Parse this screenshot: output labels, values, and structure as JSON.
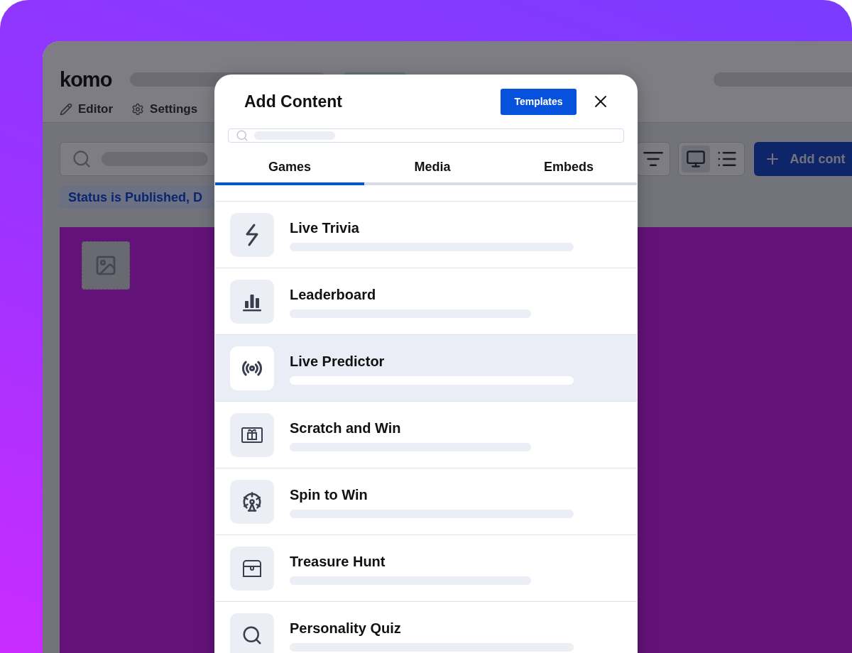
{
  "app": {
    "logo": "komo",
    "nav": [
      {
        "label": "Editor"
      },
      {
        "label": "Settings"
      }
    ],
    "status_chip": "Status is Published, D",
    "view_toggle": [
      {
        "selected": true
      },
      {
        "selected": false
      }
    ],
    "add_button": "Add cont"
  },
  "modal": {
    "title": "Add Content",
    "templates_button": "Templates",
    "tabs": [
      {
        "label": "Games",
        "selected": true
      },
      {
        "label": "Media",
        "selected": false
      },
      {
        "label": "Embeds",
        "selected": false
      }
    ],
    "items": [
      {
        "title": "Live Trivia",
        "selected": false
      },
      {
        "title": "Leaderboard",
        "selected": false
      },
      {
        "title": "Live Predictor",
        "selected": true
      },
      {
        "title": "Scratch and Win",
        "selected": false
      },
      {
        "title": "Spin to Win",
        "selected": false
      },
      {
        "title": "Treasure Hunt",
        "selected": false
      },
      {
        "title": "Personality Quiz",
        "selected": false
      }
    ]
  }
}
